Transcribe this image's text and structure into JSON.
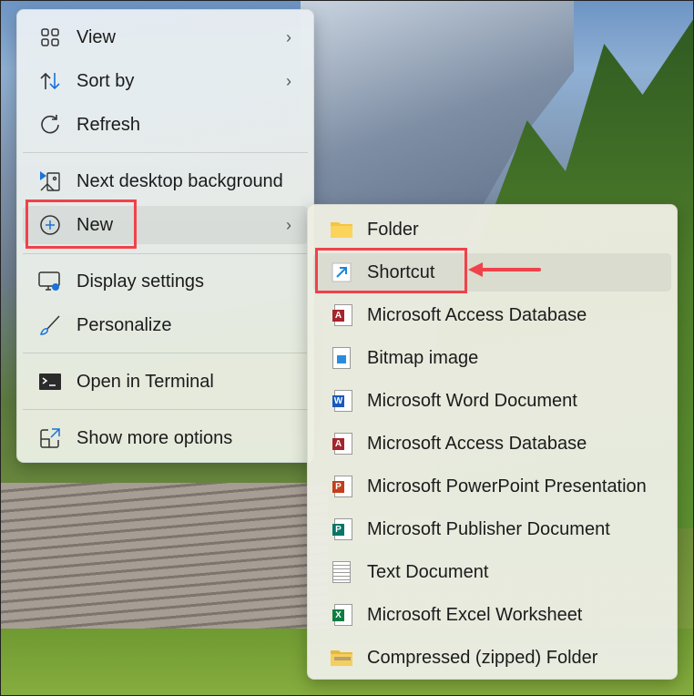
{
  "context_menu": {
    "items": [
      {
        "label": "View",
        "icon": "grid-icon",
        "submenu": true
      },
      {
        "label": "Sort by",
        "icon": "sort-arrows-icon",
        "submenu": true
      },
      {
        "label": "Refresh",
        "icon": "refresh-icon"
      },
      {
        "label": "Next desktop background",
        "icon": "next-background-icon"
      },
      {
        "label": "New",
        "icon": "plus-circle-icon",
        "submenu": true
      },
      {
        "label": "Display settings",
        "icon": "display-settings-icon"
      },
      {
        "label": "Personalize",
        "icon": "brush-icon"
      },
      {
        "label": "Open in Terminal",
        "icon": "terminal-icon"
      },
      {
        "label": "Show more options",
        "icon": "show-more-icon"
      }
    ]
  },
  "new_submenu": {
    "items": [
      {
        "label": "Folder",
        "icon": "folder-icon"
      },
      {
        "label": "Shortcut",
        "icon": "shortcut-icon"
      },
      {
        "label": "Microsoft Access Database",
        "icon": "access-icon",
        "letter": "A",
        "color": "#a4262c"
      },
      {
        "label": "Bitmap image",
        "icon": "bitmap-icon"
      },
      {
        "label": "Microsoft Word Document",
        "icon": "word-icon",
        "letter": "W",
        "color": "#185abd"
      },
      {
        "label": "Microsoft Access Database",
        "icon": "access-icon",
        "letter": "A",
        "color": "#a4262c"
      },
      {
        "label": "Microsoft PowerPoint Presentation",
        "icon": "powerpoint-icon",
        "letter": "P",
        "color": "#c43e1c"
      },
      {
        "label": "Microsoft Publisher Document",
        "icon": "publisher-icon",
        "letter": "P",
        "color": "#077568"
      },
      {
        "label": "Text Document",
        "icon": "text-document-icon"
      },
      {
        "label": "Microsoft Excel Worksheet",
        "icon": "excel-icon",
        "letter": "X",
        "color": "#107c41"
      },
      {
        "label": "Compressed (zipped) Folder",
        "icon": "zip-folder-icon"
      }
    ]
  },
  "annotation_color": "#f0424a",
  "chevron": "›"
}
